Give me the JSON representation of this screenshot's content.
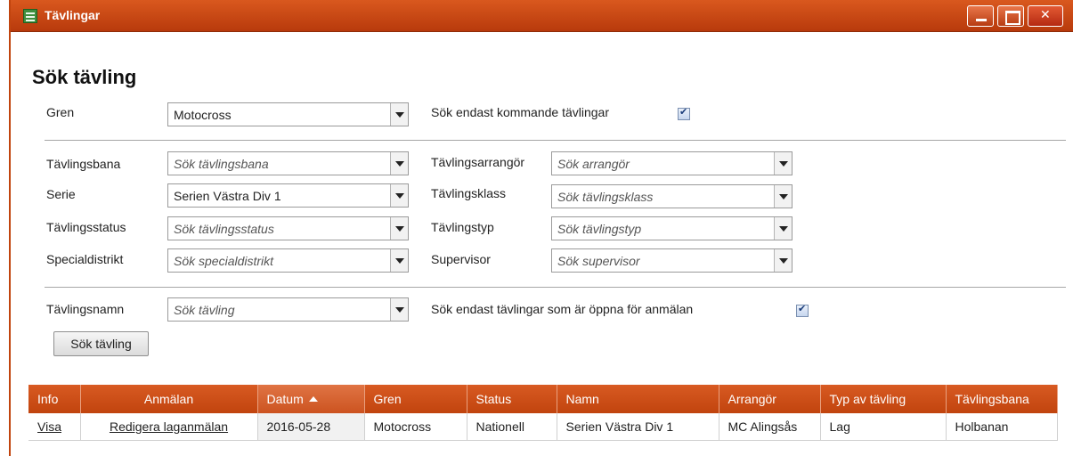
{
  "window": {
    "title": "Tävlingar"
  },
  "page": {
    "title": "Sök tävling"
  },
  "gren": {
    "label": "Gren",
    "value": "Motocross"
  },
  "upcoming": {
    "label": "Sök endast kommande tävlingar",
    "checked": true
  },
  "filters": {
    "tavlingsbana": {
      "label": "Tävlingsbana",
      "placeholder": "Sök tävlingsbana"
    },
    "serie": {
      "label": "Serie",
      "value": "Serien Västra Div 1"
    },
    "tavlingsstatus": {
      "label": "Tävlingsstatus",
      "placeholder": "Sök tävlingsstatus"
    },
    "specialdistrikt": {
      "label": "Specialdistrikt",
      "placeholder": "Sök specialdistrikt"
    },
    "arrangor": {
      "label": "Tävlingsarrangör",
      "placeholder": "Sök arrangör"
    },
    "klass": {
      "label": "Tävlingsklass",
      "placeholder": "Sök tävlingsklass"
    },
    "typ": {
      "label": "Tävlingstyp",
      "placeholder": "Sök tävlingstyp"
    },
    "supervisor": {
      "label": "Supervisor",
      "placeholder": "Sök supervisor"
    }
  },
  "name": {
    "label": "Tävlingsnamn",
    "placeholder": "Sök tävling"
  },
  "open": {
    "label": "Sök endast tävlingar som är öppna för anmälan",
    "checked": true
  },
  "search_button": "Sök tävling",
  "table": {
    "headers": [
      "Info",
      "Anmälan",
      "Datum",
      "Gren",
      "Status",
      "Namn",
      "Arrangör",
      "Typ av tävling",
      "Tävlingsbana"
    ],
    "sorted_column": "Datum",
    "sort_direction": "ascending",
    "rows": [
      {
        "info": "Visa",
        "anmalan": "Redigera laganmälan",
        "datum": "2016-05-28",
        "gren": "Motocross",
        "status": "Nationell",
        "namn": "Serien Västra Div 1",
        "arrangor": "MC Alingsås",
        "typ": "Lag",
        "bana": "Holbanan"
      }
    ]
  },
  "colors": {
    "titlebar": "#c1440e",
    "header": "#d05020"
  }
}
